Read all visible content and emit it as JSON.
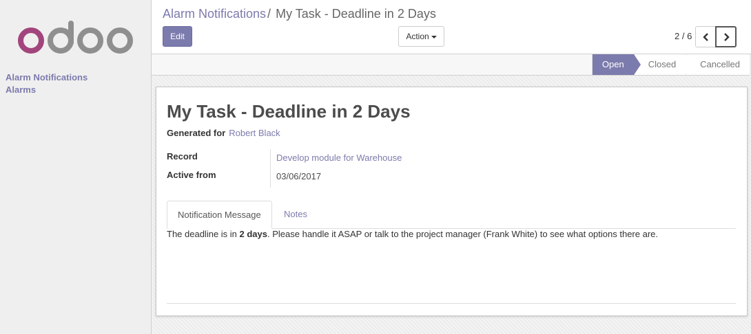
{
  "logo_text": "odoo",
  "sidebar": {
    "items": [
      {
        "label": "Alarm Notifications"
      },
      {
        "label": "Alarms"
      }
    ]
  },
  "breadcrumb": {
    "parent": "Alarm Notifications",
    "separator": "/",
    "current": "My Task - Deadline in 2 Days"
  },
  "toolbar": {
    "edit_label": "Edit",
    "action_label": "Action"
  },
  "pager": {
    "value": "2 / 6"
  },
  "statusbar": {
    "stages": [
      {
        "label": "Open",
        "active": true
      },
      {
        "label": "Closed",
        "active": false
      },
      {
        "label": "Cancelled",
        "active": false
      }
    ]
  },
  "record": {
    "title": "My Task - Deadline in 2 Days",
    "generated_for_label": "Generated for",
    "generated_for_value": "Robert Black",
    "fields": [
      {
        "label": "Record",
        "value": "Develop module for Warehouse"
      },
      {
        "label": "Active from",
        "value": "03/06/2017"
      }
    ]
  },
  "tabs": [
    {
      "label": "Notification Message"
    },
    {
      "label": "Notes"
    }
  ],
  "message": {
    "before": "The deadline is in ",
    "bold": "2 days",
    "after": ". Please handle it ASAP or talk to the project manager (Frank White) to see what options there are."
  },
  "colors": {
    "brand": "#7c7bad",
    "logo_o": "#a2457d",
    "logo_doo": "#8f8f8f"
  }
}
